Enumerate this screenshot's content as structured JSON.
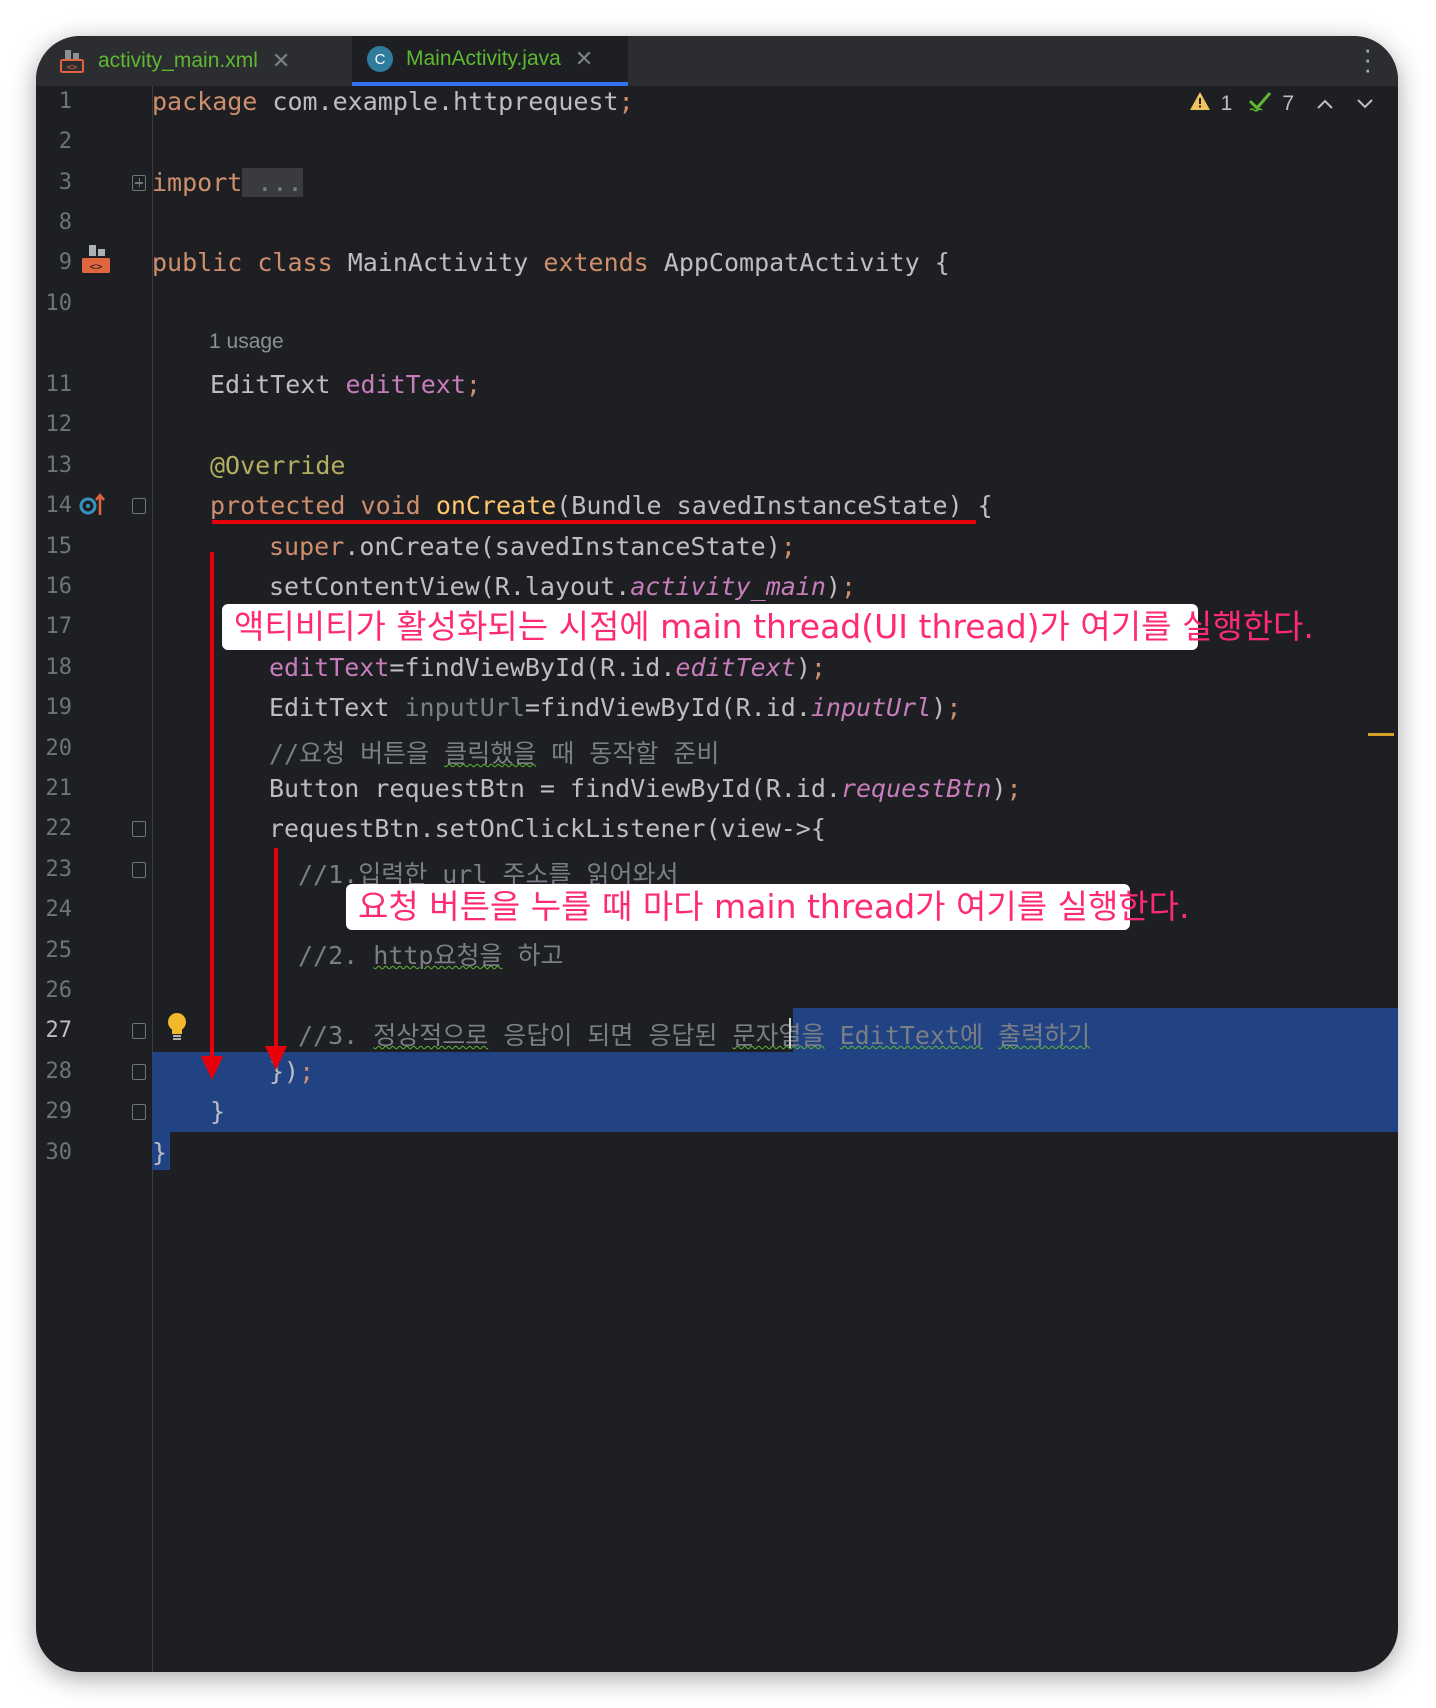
{
  "tabs": [
    {
      "label": "activity_main.xml",
      "icon": "xml-layout-icon",
      "active": false
    },
    {
      "label": "MainActivity.java",
      "icon": "java-class-icon",
      "active": true
    }
  ],
  "inspections": {
    "warnings": "1",
    "checks": "7"
  },
  "line_numbers": [
    "1",
    "2",
    "3",
    "8",
    "9",
    "10",
    "11",
    "12",
    "13",
    "14",
    "15",
    "16",
    "17",
    "18",
    "19",
    "20",
    "21",
    "22",
    "23",
    "24",
    "25",
    "26",
    "27",
    "28",
    "29",
    "30"
  ],
  "code": {
    "l1_kw": "package",
    "l1_rest": " com.example.httprequest",
    "l1_semi": ";",
    "l3_kw": "import",
    "l3_fold": " ...",
    "l9_kw1": "public",
    "l9_kw2": "class",
    "l9_name": " MainActivity ",
    "l9_kw3": "extends",
    "l9_rest": " AppCompatActivity {",
    "usage_hint": "1 usage",
    "l11_type": "EditText ",
    "l11_field": "editText",
    "l11_semi": ";",
    "l13_ann": "@Override",
    "l14_kw1": "protected",
    "l14_kw2": "void",
    "l14_fn": "onCreate",
    "l14_rest": "(Bundle savedInstanceState) {",
    "l15_kw": "super",
    "l15_rest": ".onCreate(savedInstanceState)",
    "l15_semi": ";",
    "l16_a": "setContentView(R.layout.",
    "l16_b": "activity_main",
    "l16_c": ")",
    "l16_semi": ";",
    "l18_field": "editText",
    "l18_a": "=findViewById(R.id.",
    "l18_b": "editText",
    "l18_c": ")",
    "l18_semi": ";",
    "l19_type": "EditText ",
    "l19_var": "inputUrl",
    "l19_a": "=findViewById(R.id.",
    "l19_b": "inputUrl",
    "l19_c": ")",
    "l19_semi": ";",
    "l20_a": "//요청 버튼을 ",
    "l20_b": "클릭했을",
    "l20_c": " 때 동작할 준비",
    "l21_a": "Button requestBtn = findViewById(R.id.",
    "l21_b": "requestBtn",
    "l21_c": ")",
    "l21_semi": ";",
    "l22": "requestBtn.setOnClickListener(view->{",
    "l23_a": "//1.입력한 url 주소를 ",
    "l23_b": "읽어와서",
    "l25_a": "//2. ",
    "l25_b": "http요청을",
    "l25_c": " 하고",
    "l27_a": "//3. ",
    "l27_b": "정상적으로",
    "l27_c": " 응답이 되면 응답된 ",
    "l27_d": "문자열을",
    "l27_e": " ",
    "l27_f": "EditText에",
    "l27_g": " ",
    "l27_h": "출력하기",
    "l28": "})",
    "l28_semi": ";",
    "l29": "}",
    "l30": "}"
  },
  "callouts": {
    "activity": "액티비티가 활성화되는 시점에 main thread(UI thread)가 여기를 실행한다.",
    "button": "요청 버튼을 누를 때 마다 main thread가 여기를 실행한다."
  },
  "colors": {
    "background": "#1e1f22",
    "keyword": "#cf8e6d",
    "field": "#c77dbb",
    "annotation": "#b3ae60",
    "selection": "#214283",
    "callout_text": "#ff2a76",
    "annotation_red": "#e8000b",
    "tab_title": "#5fb832"
  }
}
